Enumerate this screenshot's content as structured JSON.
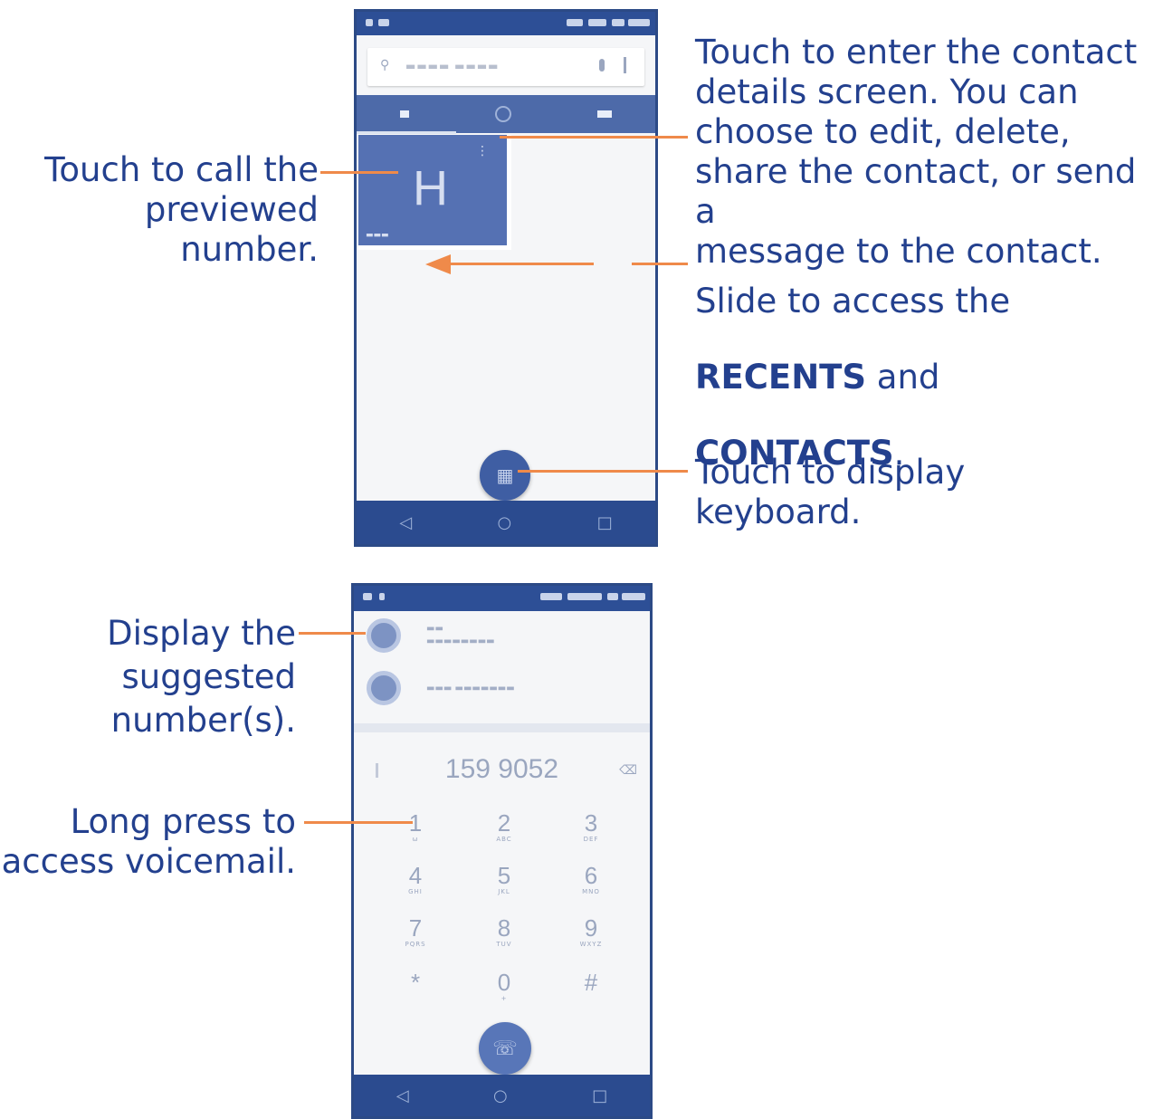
{
  "callouts": {
    "call_previewed": "Touch to call the\npreviewed number.",
    "contact_details": "Touch to enter the contact\ndetails screen. You can\nchoose to edit, delete,\nshare the contact, or send a\nmessage to the contact.",
    "slide_line1": "Slide to access the",
    "slide_recents": "RECENTS",
    "slide_and": " and",
    "slide_contacts": "CONTACTS",
    "slide_period": ".",
    "keyboard": "Touch to display\nkeyboard.",
    "suggested": "Display the\nsuggested\nnumber(s).",
    "voicemail": "Long press to\naccess voicemail."
  },
  "top_phone": {
    "contact_letter": "H"
  },
  "bottom_phone": {
    "dialed_number": "159 9052",
    "keys": [
      {
        "n": "1",
        "l": "ω"
      },
      {
        "n": "2",
        "l": "ABC"
      },
      {
        "n": "3",
        "l": "DEF"
      },
      {
        "n": "4",
        "l": "GHI"
      },
      {
        "n": "5",
        "l": "JKL"
      },
      {
        "n": "6",
        "l": "MNO"
      },
      {
        "n": "7",
        "l": "PQRS"
      },
      {
        "n": "8",
        "l": "TUV"
      },
      {
        "n": "9",
        "l": "WXYZ"
      },
      {
        "n": "*",
        "l": ""
      },
      {
        "n": "0",
        "l": "+"
      },
      {
        "n": "#",
        "l": ""
      }
    ]
  },
  "colors": {
    "accent_orange": "#ef8a4a",
    "text_blue": "#23408e",
    "phone_blue": "#2d4f96"
  },
  "icons": {
    "search": "search-icon",
    "mic": "mic-icon",
    "more": "more-vert-icon",
    "speed_dial_tab": "star-icon",
    "recents_tab": "clock-icon",
    "contacts_tab": "people-icon",
    "dialpad_fab": "dialpad-icon",
    "call_fab": "phone-icon",
    "back": "back-icon",
    "home": "home-icon",
    "recents": "recents-icon"
  }
}
